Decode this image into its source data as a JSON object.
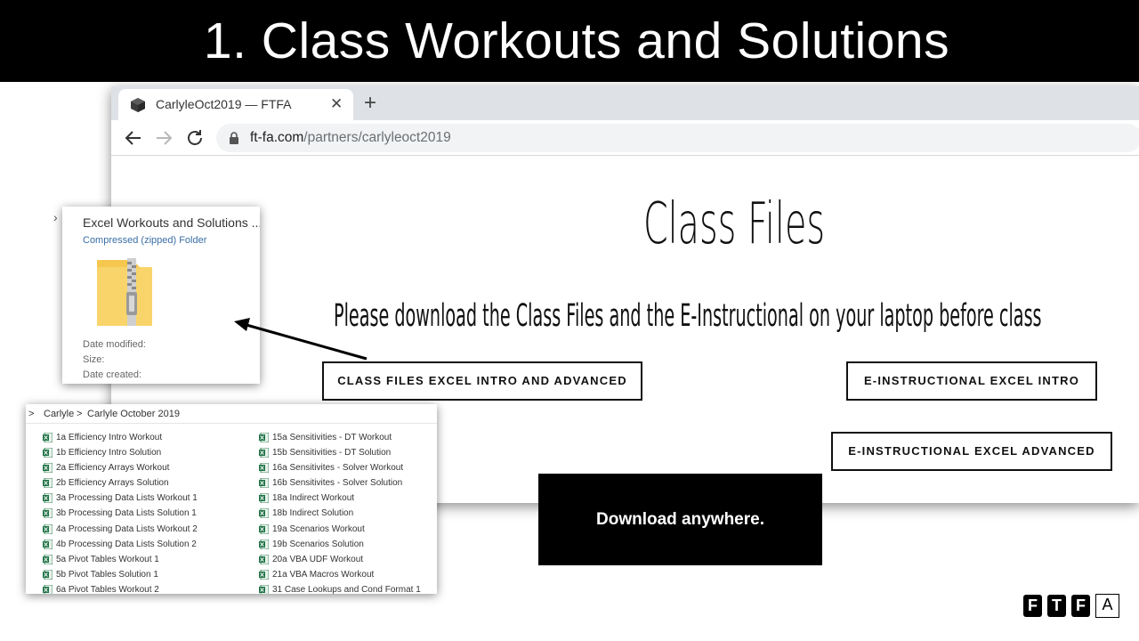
{
  "slide": {
    "title": "1. Class Workouts and Solutions",
    "callout": "Download anywhere.",
    "logo_letters": [
      "F",
      "T",
      "F",
      "A"
    ]
  },
  "browser": {
    "tab_title": "CarlyleOct2019 — FTFA",
    "tab_close": "✕",
    "new_tab": "+",
    "url_host": "ft-fa.com",
    "url_path": "/partners/carlyleoct2019",
    "page": {
      "heading": "Class Files",
      "subheading": "Please download the Class Files and the E-Instructional on your laptop before class",
      "buttons": {
        "class_files": "CLASS FILES EXCEL INTRO AND ADVANCED",
        "einstructional_intro": "E-INSTRUCTIONAL EXCEL INTRO",
        "einstructional_advanced": "E-INSTRUCTIONAL EXCEL ADVANCED"
      }
    }
  },
  "zip_popup": {
    "name": "Excel Workouts and Solutions ...",
    "type": "Compressed (zipped) Folder",
    "date_modified_label": "Date modified:",
    "size_label": "Size:",
    "date_created_label": "Date created:",
    "folder_color": "#f5c74e"
  },
  "explorer": {
    "breadcrumb": [
      "Carlyle",
      "Carlyle October 2019"
    ],
    "breadcrumb_sep": ">",
    "files_col1": [
      "1a Efficiency Intro Workout",
      "1b Efficiency Intro Solution",
      "2a Efficiency Arrays Workout",
      "2b Efficiency Arrays Solution",
      "3a Processing Data Lists Workout 1",
      "3b Processing Data Lists Solution 1",
      "4a Processing Data Lists Workout 2",
      "4b Processing Data Lists Solution 2",
      "5a Pivot Tables Workout 1",
      "5b Pivot Tables Solution 1",
      "6a Pivot Tables Workout 2"
    ],
    "files_col2": [
      "15a Sensitivities - DT Workout",
      "15b Sensitivities - DT Solution",
      "16a Sensitivites - Solver Workout",
      "16b Sensitivites - Solver Solution",
      "18a Indirect Workout",
      "18b Indirect Solution",
      "19a Scenarios Workout",
      "19b Scenarios Solution",
      "20a VBA UDF Workout",
      "21a VBA Macros Workout",
      "31 Case Lookups and Cond Format 1"
    ],
    "excel_icon_color": "#1e7145"
  }
}
